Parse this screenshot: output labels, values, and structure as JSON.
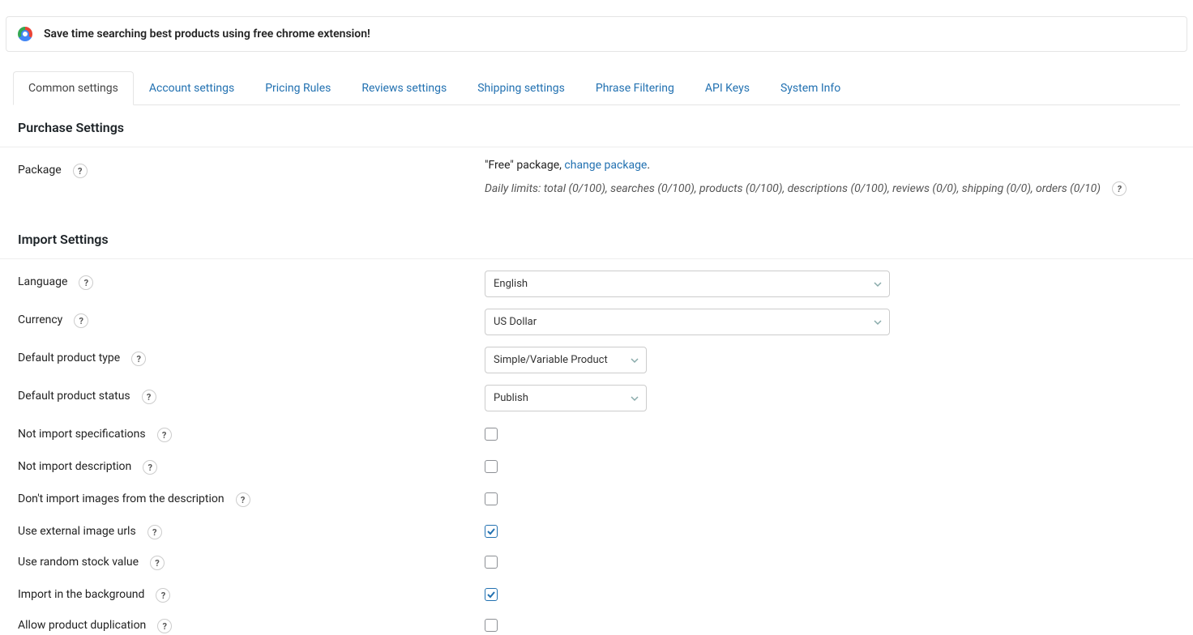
{
  "banner": {
    "text": "Save time searching best products using free chrome extension!"
  },
  "tabs": [
    {
      "label": "Common settings",
      "active": true
    },
    {
      "label": "Account settings",
      "active": false
    },
    {
      "label": "Pricing Rules",
      "active": false
    },
    {
      "label": "Reviews settings",
      "active": false
    },
    {
      "label": "Shipping settings",
      "active": false
    },
    {
      "label": "Phrase Filtering",
      "active": false
    },
    {
      "label": "API Keys",
      "active": false
    },
    {
      "label": "System Info",
      "active": false
    }
  ],
  "sections": {
    "purchase": {
      "title": "Purchase Settings"
    },
    "import": {
      "title": "Import Settings"
    }
  },
  "purchase": {
    "package_label": "Package",
    "pkg_prefix": "\"Free\" package, ",
    "pkg_link": "change package",
    "pkg_suffix": ".",
    "limits": "Daily limits: total (0/100), searches (0/100), products (0/100), descriptions (0/100), reviews (0/0), shipping (0/0), orders (0/10)"
  },
  "import": {
    "language_label": "Language",
    "language_value": "English",
    "currency_label": "Currency",
    "currency_value": "US Dollar",
    "ptype_label": "Default product type",
    "ptype_value": "Simple/Variable Product",
    "pstatus_label": "Default product status",
    "pstatus_value": "Publish",
    "not_import_specs_label": "Not import specifications",
    "not_import_specs_checked": false,
    "not_import_desc_label": "Not import description",
    "not_import_desc_checked": false,
    "dont_import_images_label": "Don't import images from the description",
    "dont_import_images_checked": false,
    "use_external_urls_label": "Use external image urls",
    "use_external_urls_checked": true,
    "random_stock_label": "Use random stock value",
    "random_stock_checked": false,
    "import_bg_label": "Import in the background",
    "import_bg_checked": true,
    "allow_dup_label": "Allow product duplication",
    "allow_dup_checked": false
  },
  "glyphs": {
    "question": "?"
  }
}
